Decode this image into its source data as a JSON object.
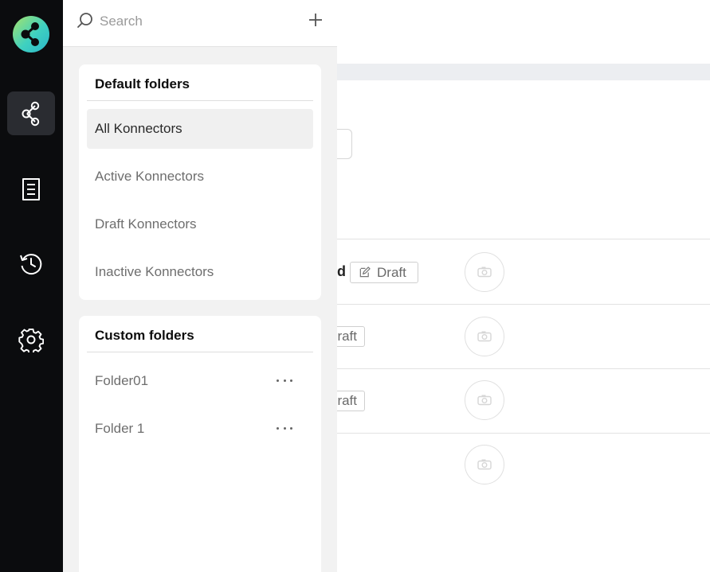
{
  "search": {
    "placeholder": "Search"
  },
  "rail": {
    "items": [
      {
        "icon": "share-nodes-icon",
        "active": true
      },
      {
        "icon": "document-list-icon",
        "active": false
      },
      {
        "icon": "history-icon",
        "active": false
      },
      {
        "icon": "gear-icon",
        "active": false
      }
    ]
  },
  "default_folders": {
    "title": "Default folders",
    "items": [
      {
        "label": "All Konnectors",
        "selected": true
      },
      {
        "label": "Active Konnectors",
        "selected": false
      },
      {
        "label": "Draft Konnectors",
        "selected": false
      },
      {
        "label": "Inactive Konnectors",
        "selected": false
      }
    ]
  },
  "custom_folders": {
    "title": "Custom folders",
    "items": [
      {
        "label": "Folder01"
      },
      {
        "label": "Folder 1"
      }
    ]
  },
  "background": {
    "row1_suffix": "d",
    "row1_badge": "Draft",
    "row2_badge_partial": "raft",
    "row3_badge_partial": "raft"
  },
  "colors": {
    "rail_bg": "#0b0c0e",
    "rail_active": "#2a2c31",
    "panel_bg": "#f2f2f2",
    "selected_item_bg": "#f0f0f0"
  }
}
